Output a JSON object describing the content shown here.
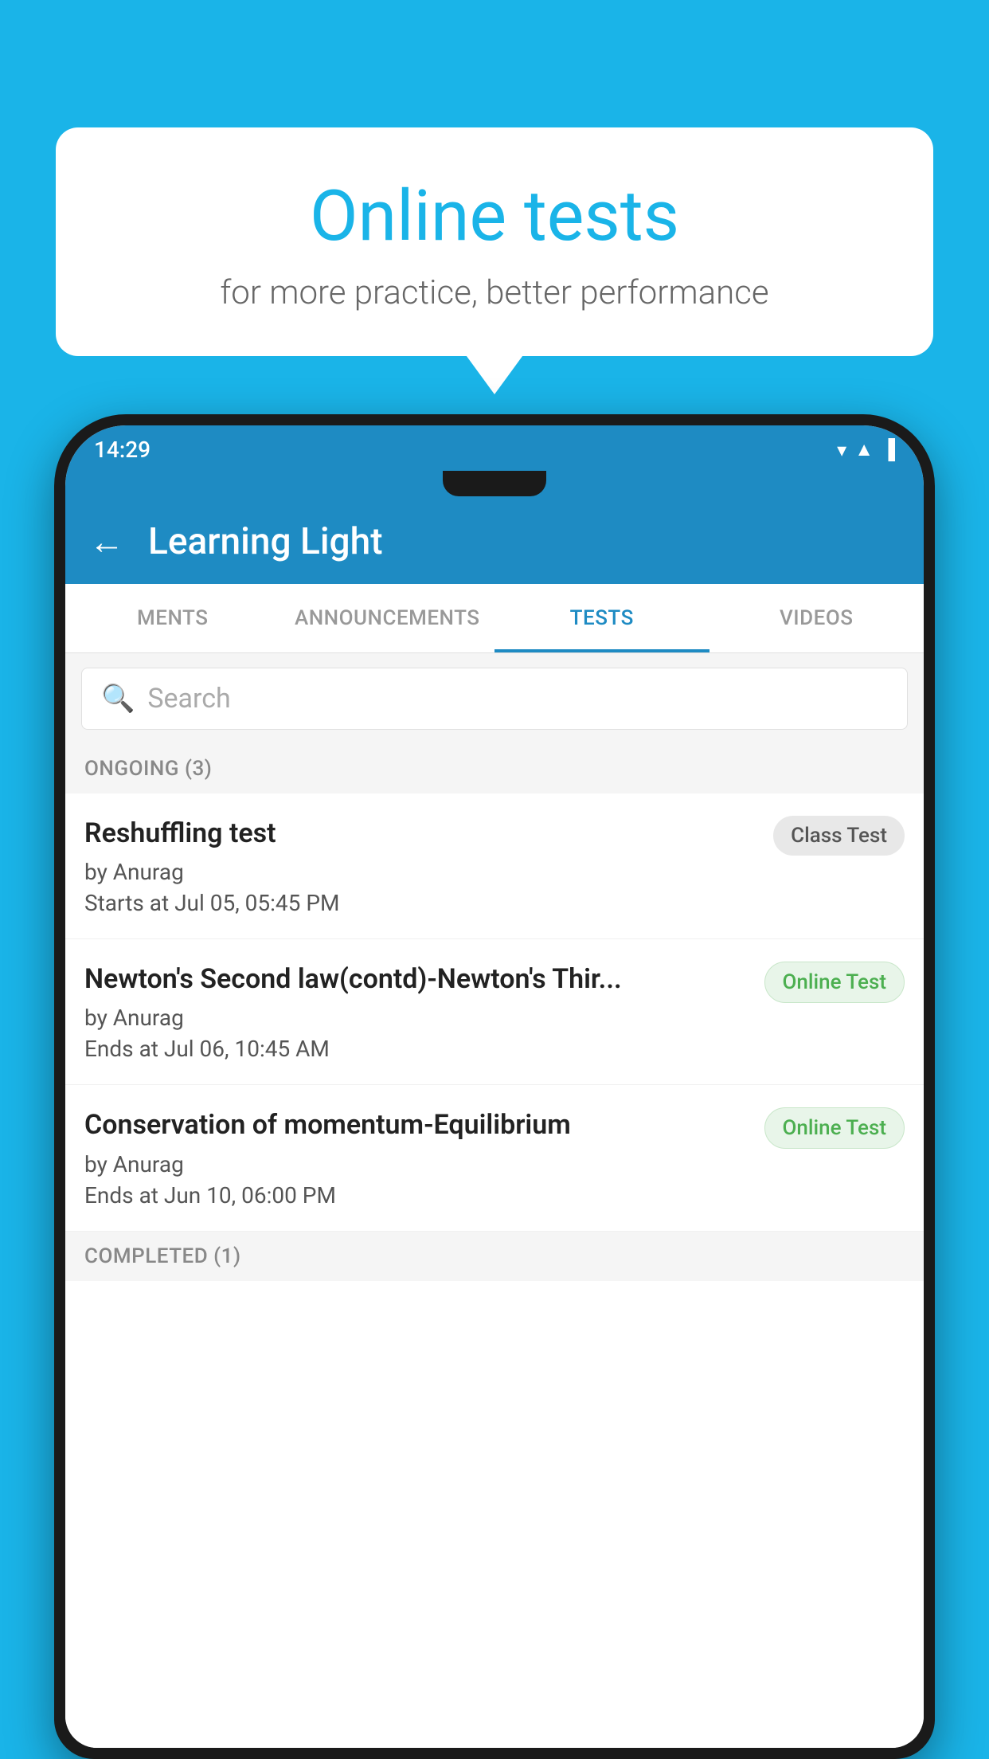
{
  "background_color": "#1ab4e8",
  "speech_bubble": {
    "title": "Online tests",
    "subtitle": "for more practice, better performance"
  },
  "phone": {
    "status_bar": {
      "time": "14:29",
      "icons": [
        "▼",
        "▲",
        "▐"
      ]
    },
    "app_bar": {
      "back_label": "←",
      "title": "Learning Light"
    },
    "tabs": [
      {
        "label": "MENTS",
        "active": false
      },
      {
        "label": "ANNOUNCEMENTS",
        "active": false
      },
      {
        "label": "TESTS",
        "active": true
      },
      {
        "label": "VIDEOS",
        "active": false
      }
    ],
    "search": {
      "placeholder": "Search"
    },
    "section_ongoing": {
      "label": "ONGOING (3)"
    },
    "tests": [
      {
        "name": "Reshuffling test",
        "author": "by Anurag",
        "date": "Starts at  Jul 05, 05:45 PM",
        "badge": "Class Test",
        "badge_type": "class"
      },
      {
        "name": "Newton's Second law(contd)-Newton's Thir...",
        "author": "by Anurag",
        "date": "Ends at  Jul 06, 10:45 AM",
        "badge": "Online Test",
        "badge_type": "online"
      },
      {
        "name": "Conservation of momentum-Equilibrium",
        "author": "by Anurag",
        "date": "Ends at  Jun 10, 06:00 PM",
        "badge": "Online Test",
        "badge_type": "online"
      }
    ],
    "section_completed": {
      "label": "COMPLETED (1)"
    }
  }
}
